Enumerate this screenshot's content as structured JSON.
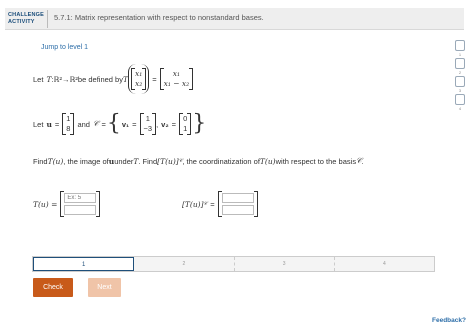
{
  "header": {
    "tag_line1": "CHALLENGE",
    "tag_line2": "ACTIVITY",
    "title": "5.7.1: Matrix representation with respect to nonstandard bases."
  },
  "jump_link": "Jump to level 1",
  "levels": [
    "1",
    "2",
    "3",
    "4"
  ],
  "problem": {
    "let": "Let",
    "T": "T",
    "colon": " : ",
    "R2a": "ℝ²",
    "arrow": " → ",
    "R2b": "ℝ²",
    "defined_by": " be defined by ",
    "x1": "x₁",
    "x2": "x₂",
    "eq": "=",
    "r1": "x₁",
    "r2": "x₁ − x₂",
    "let_u": "Let",
    "u": "u",
    "u1": "1",
    "u2": "8",
    "and": "and",
    "C": "𝒞",
    "v1": "v₁",
    "v1a": "1",
    "v1b": "−3",
    "comma": ",",
    "v2": "v₂",
    "v2a": "0",
    "v2b": "1",
    "find_text_1": "Find ",
    "find_Tu": "T(u)",
    "find_text_2": ", the image of ",
    "find_u": "u",
    "find_text_3": " under ",
    "find_T": "T",
    "find_text_4": ". Find ",
    "find_TuC": "[T(u)]",
    "find_sub": "𝒞",
    "find_text_5": ", the coordinatization of ",
    "find_Tu2": "T(u)",
    "find_text_6": " with respect to the basis ",
    "find_C": "𝒞",
    "find_text_7": "."
  },
  "answers": {
    "lhs1": "T(u) =",
    "lhs2": "[T(u)]",
    "lhs2_sub": "𝒞",
    "lhs2_eq": "=",
    "placeholder1": "Ex: 5",
    "placeholder_empty": ""
  },
  "progress": {
    "segments": [
      "1",
      "2",
      "3",
      "4"
    ]
  },
  "buttons": {
    "check": "Check",
    "next": "Next"
  },
  "feedback": "Feedback?"
}
